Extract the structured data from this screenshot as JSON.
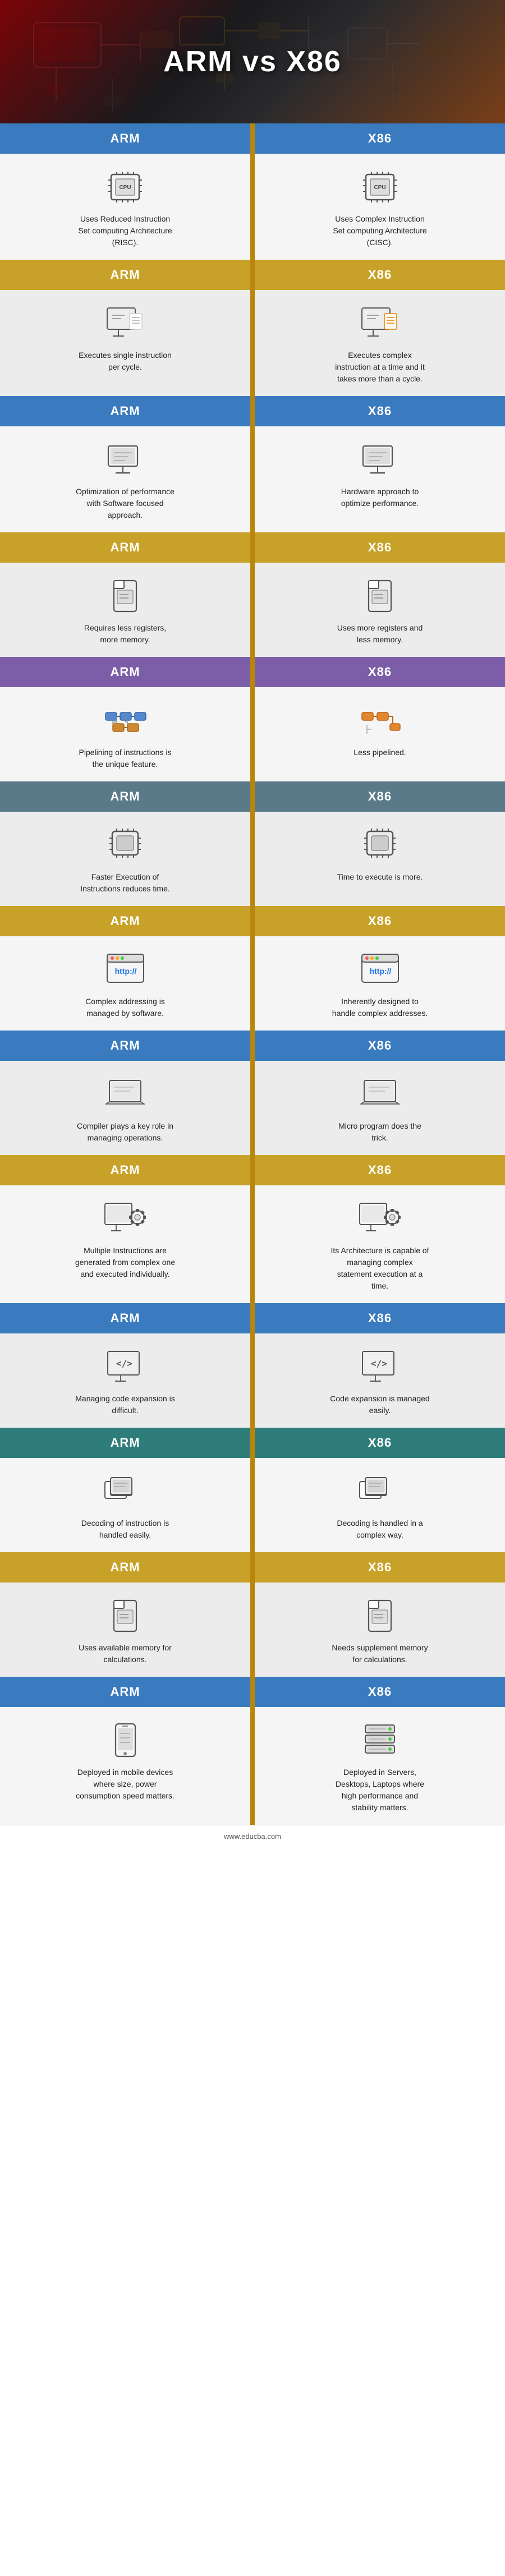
{
  "header": {
    "title": "ARM vs X86"
  },
  "footer": {
    "url": "www.educba.com"
  },
  "sections": [
    {
      "bar_color_arm": "arm-blue",
      "bar_color_x86": "x86-blue",
      "arm_label": "ARM",
      "x86_label": "X86",
      "arm_text": "Uses Reduced Instruction Set computing Architecture (RISC).",
      "x86_text": "Uses Complex Instruction Set computing Architecture (CISC).",
      "arm_icon": "chip",
      "x86_icon": "chip"
    },
    {
      "bar_color_arm": "arm-gold",
      "bar_color_x86": "x86-gold",
      "arm_label": "ARM",
      "x86_label": "X86",
      "arm_text": "Executes single instruction per cycle.",
      "x86_text": "Executes complex instruction at a time and it takes more than a cycle.",
      "arm_icon": "monitor-file",
      "x86_icon": "monitor-file-orange"
    },
    {
      "bar_color_arm": "arm-blue",
      "bar_color_x86": "x86-blue",
      "arm_label": "ARM",
      "x86_label": "X86",
      "arm_text": "Optimization of performance with Software focused approach.",
      "x86_text": "Hardware approach to optimize performance.",
      "arm_icon": "desktop",
      "x86_icon": "desktop"
    },
    {
      "bar_color_arm": "arm-gold",
      "bar_color_x86": "x86-gold",
      "arm_label": "ARM",
      "x86_label": "X86",
      "arm_text": "Requires less registers, more memory.",
      "x86_text": "Uses more registers and less memory.",
      "arm_icon": "simcard",
      "x86_icon": "simcard"
    },
    {
      "bar_color_arm": "arm-purple",
      "bar_color_x86": "x86-purple",
      "arm_label": "ARM",
      "x86_label": "X86",
      "arm_text": "Pipelining of instructions is the unique feature.",
      "x86_text": "Less pipelined.",
      "arm_icon": "pipeline",
      "x86_icon": "pipeline-orange"
    },
    {
      "bar_color_arm": "arm-gray",
      "bar_color_x86": "x86-gray",
      "arm_label": "ARM",
      "x86_label": "X86",
      "arm_text": "Faster Execution of Instructions reduces time.",
      "x86_text": "Time to execute is more.",
      "arm_icon": "chip2",
      "x86_icon": "chip2"
    },
    {
      "bar_color_arm": "arm-gold",
      "bar_color_x86": "x86-gold",
      "arm_label": "ARM",
      "x86_label": "X86",
      "arm_text": "Complex addressing is managed by software.",
      "x86_text": "Inherently designed to handle complex addresses.",
      "arm_icon": "http",
      "x86_icon": "http"
    },
    {
      "bar_color_arm": "arm-blue",
      "bar_color_x86": "x86-blue",
      "arm_label": "ARM",
      "x86_label": "X86",
      "arm_text": "Compiler plays a key role in managing operations.",
      "x86_text": "Micro program does the trick.",
      "arm_icon": "laptop",
      "x86_icon": "laptop"
    },
    {
      "bar_color_arm": "arm-gold",
      "bar_color_x86": "x86-gold",
      "arm_label": "ARM",
      "x86_label": "X86",
      "arm_text": "Multiple Instructions are generated from complex one and executed individually.",
      "x86_text": "Its Architecture is capable of managing complex statement execution at a time.",
      "arm_icon": "gear-monitor",
      "x86_icon": "gear-monitor"
    },
    {
      "bar_color_arm": "arm-blue",
      "bar_color_x86": "x86-blue",
      "arm_label": "ARM",
      "x86_label": "X86",
      "arm_text": "Managing code expansion is difficult.",
      "x86_text": "Code expansion is managed easily.",
      "arm_icon": "code-monitor",
      "x86_icon": "code-monitor"
    },
    {
      "bar_color_arm": "arm-teal",
      "bar_color_x86": "x86-teal",
      "arm_label": "ARM",
      "x86_label": "X86",
      "arm_text": "Decoding of instruction is handled easily.",
      "x86_text": "Decoding is handled in a complex way.",
      "arm_icon": "multi-window",
      "x86_icon": "multi-window"
    },
    {
      "bar_color_arm": "arm-gold",
      "bar_color_x86": "x86-gold",
      "arm_label": "ARM",
      "x86_label": "X86",
      "arm_text": "Uses available memory for calculations.",
      "x86_text": "Needs supplement memory for calculations.",
      "arm_icon": "simcard2",
      "x86_icon": "simcard2"
    },
    {
      "bar_color_arm": "arm-blue",
      "bar_color_x86": "x86-blue",
      "arm_label": "ARM",
      "x86_label": "X86",
      "arm_text": "Deployed in mobile devices where size, power consumption speed matters.",
      "x86_text": "Deployed in Servers, Desktops, Laptops where high performance and stability matters.",
      "arm_icon": "mobile",
      "x86_icon": "server"
    }
  ]
}
